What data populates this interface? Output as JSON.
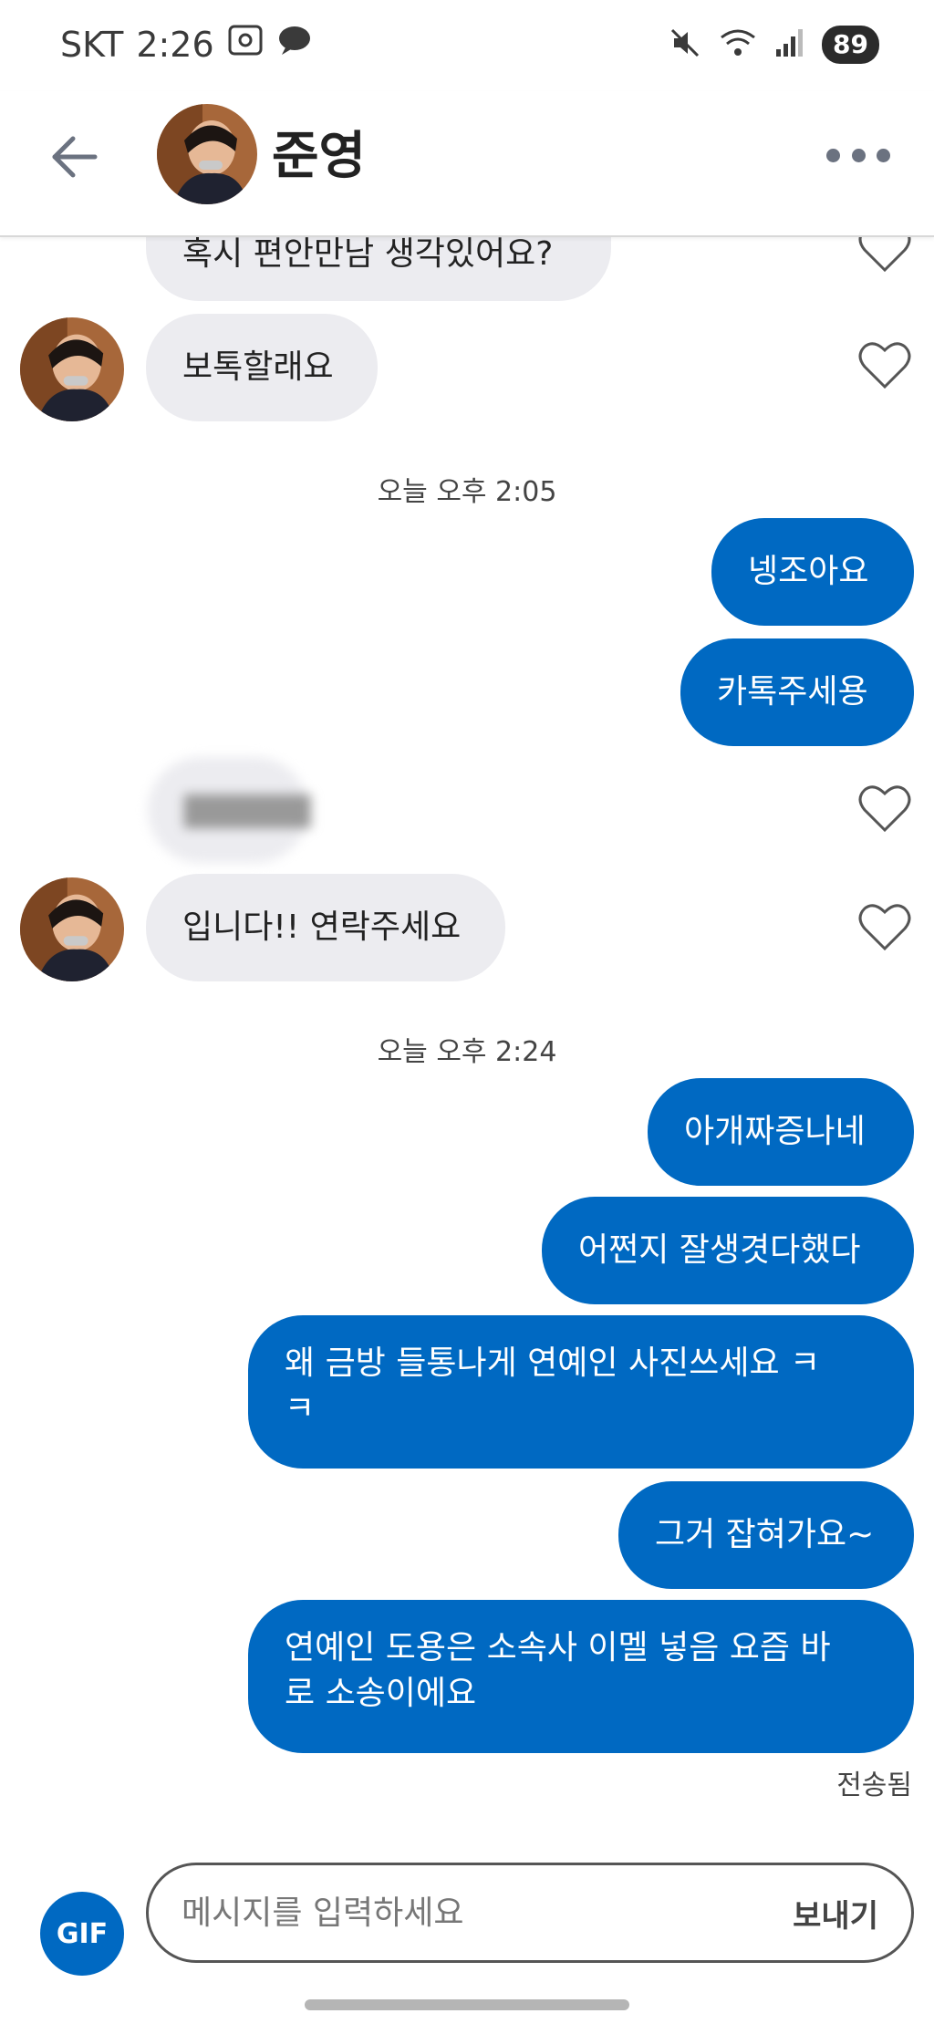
{
  "status_bar": {
    "carrier": "SKT",
    "time": "2:26",
    "battery": "89"
  },
  "header": {
    "contact_name": "준영"
  },
  "messages": {
    "m0": "혹시 편안만남 생각있어요?",
    "m1": "보톡할래요",
    "ts1": "오늘 오후 2:05",
    "m2": "넹조아요",
    "m3": "카톡주세용",
    "m4": "▇▇▇▇▇",
    "m5": "입니다!! 연락주세요",
    "ts2": "오늘 오후 2:24",
    "m6": "아개짜증나네",
    "m7": "어쩐지 잘생겻다했다",
    "m8": "왜 금방 들통나게 연예인 사진쓰세요 ㅋ ㅋ",
    "m9": "그거 잡혀가요~",
    "m10": "연예인 도용은 소속사 이멜 넣음 요즘 바로 소송이에요",
    "status": "전송됨"
  },
  "input": {
    "gif_label": "GIF",
    "placeholder": "메시지를 입력하세요",
    "send_label": "보내기"
  },
  "colors": {
    "outgoing_bubble": "#0069c2",
    "incoming_bubble": "#ececf0"
  }
}
